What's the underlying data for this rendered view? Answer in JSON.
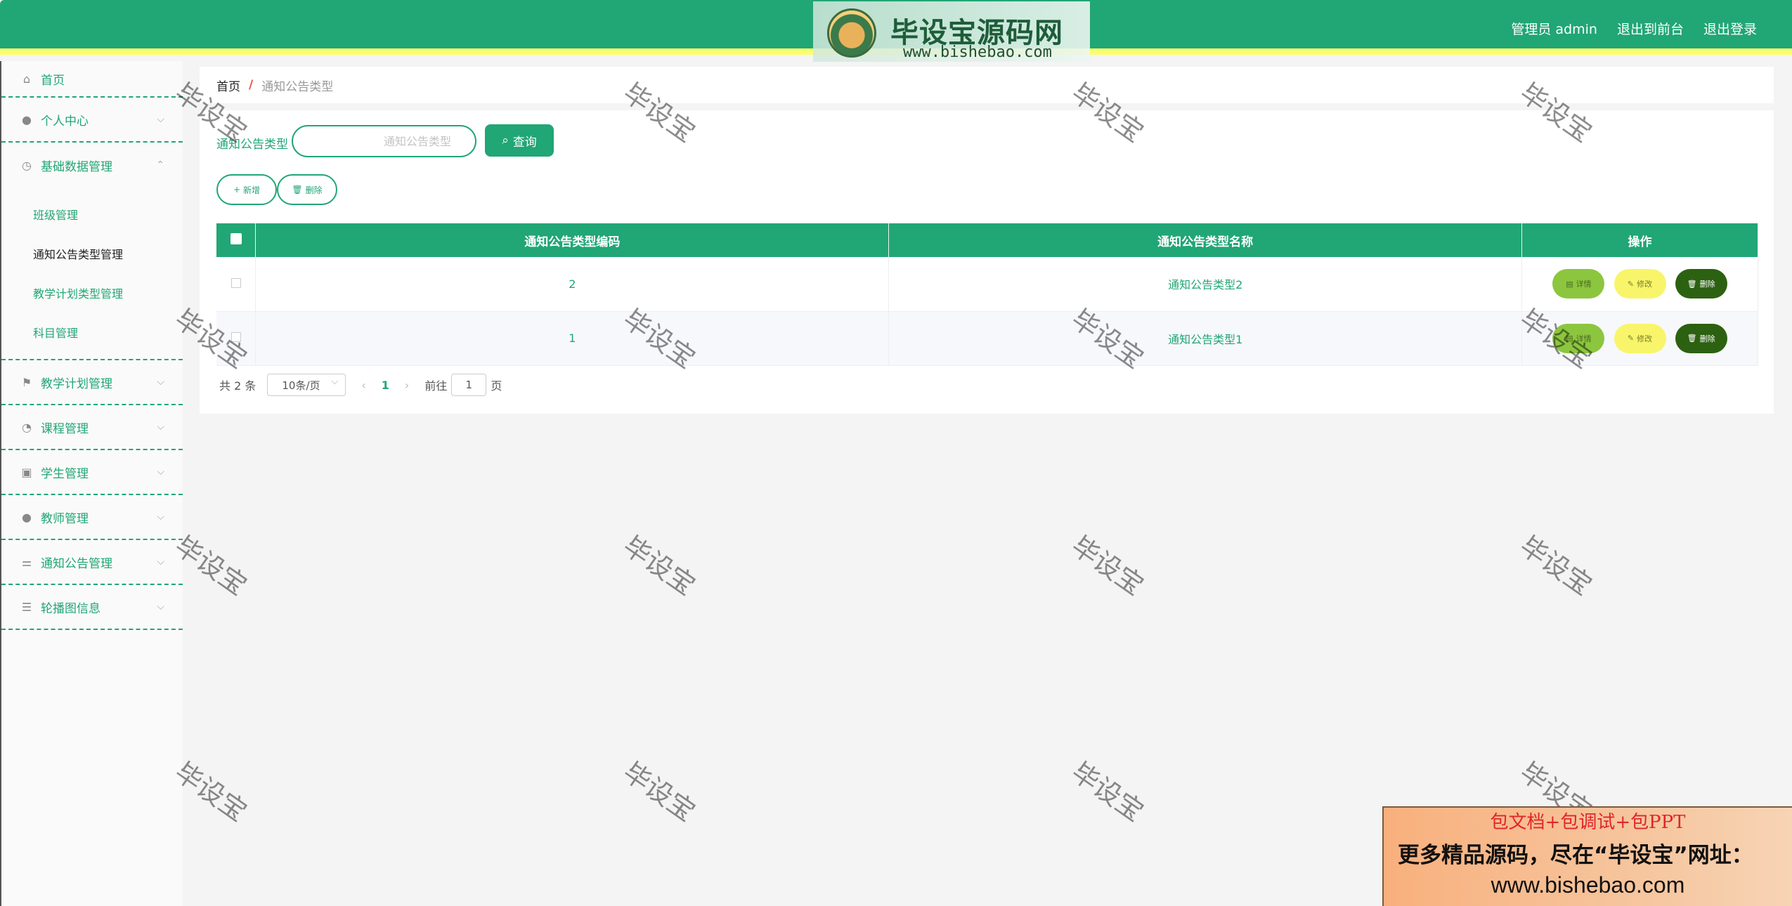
{
  "header": {
    "brand_title": "毕设宝源码网",
    "brand_url": "www.bishebao.com",
    "links": [
      "管理员 admin",
      "退出到前台",
      "退出登录"
    ]
  },
  "sidebar": {
    "home": "首页",
    "items": [
      {
        "label": "个人中心",
        "icon": "user-icon"
      },
      {
        "label": "基础数据管理",
        "icon": "clock-icon"
      },
      {
        "label": "教学计划管理",
        "icon": "flag-icon"
      },
      {
        "label": "课程管理",
        "icon": "dashboard-icon"
      },
      {
        "label": "学生管理",
        "icon": "clipboard-icon"
      },
      {
        "label": "教师管理",
        "icon": "teacher-icon"
      },
      {
        "label": "通知公告管理",
        "icon": "sliders-icon"
      },
      {
        "label": "轮播图信息",
        "icon": "list-icon"
      }
    ],
    "submenu": [
      "班级管理",
      "通知公告类型管理",
      "教学计划类型管理",
      "科目管理"
    ]
  },
  "breadcrumb": {
    "home": "首页",
    "separator": "/",
    "current": "通知公告类型"
  },
  "search": {
    "label": "通知公告类型",
    "placeholder": "通知公告类型",
    "button": "查询"
  },
  "actions": {
    "add": "新增",
    "delete": "删除"
  },
  "table": {
    "columns": [
      "通知公告类型编码",
      "通知公告类型名称",
      "操作"
    ],
    "rows": [
      {
        "code": "2",
        "name": "通知公告类型2"
      },
      {
        "code": "1",
        "name": "通知公告类型1"
      }
    ],
    "row_buttons": {
      "detail": "详情",
      "edit": "修改",
      "delete": "删除"
    }
  },
  "pagination": {
    "total": "共 2 条",
    "page_size": "10条/页",
    "current_page": "1",
    "goto_label": "前往",
    "goto_value": "1",
    "page_suffix": "页"
  },
  "watermark": "毕设宝",
  "ad": {
    "line1": "包文档+包调试+包PPT",
    "line2": "更多精品源码，尽在“毕设宝”网址：",
    "line3": "www.bishebao.com"
  },
  "colors": {
    "primary": "#21a675",
    "accent_yellow": "#fbff6e",
    "detail_btn": "#8cc63f",
    "edit_btn": "#f8f56a",
    "delete_btn": "#2c6111"
  }
}
